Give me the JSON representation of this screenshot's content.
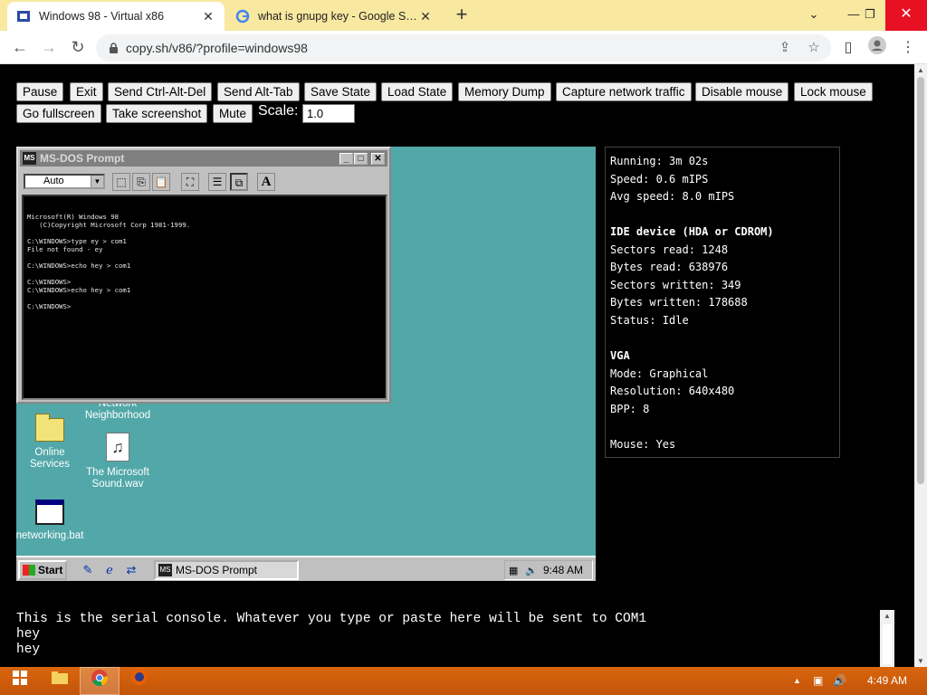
{
  "browser": {
    "tabs": [
      {
        "title": "Windows 98 - Virtual x86",
        "active": true,
        "favicon": "v86-icon"
      },
      {
        "title": "what is gnupg key - Google Search",
        "active": false,
        "favicon": "google-icon"
      }
    ],
    "new_tab_icon": "plus-icon",
    "window_controls": [
      "chevron-down-icon",
      "minimize-icon",
      "restore-icon",
      "close-icon"
    ],
    "nav": {
      "back": "arrow-left-icon",
      "forward": "arrow-right-icon",
      "reload": "reload-icon"
    },
    "url": "copy.sh/v86/?profile=windows98",
    "lock_icon": "lock-icon",
    "toolbar_icons": [
      "share-icon",
      "star-icon",
      "side-panel-icon",
      "profile-icon",
      "menu-icon"
    ]
  },
  "controls": {
    "buttons": [
      "Pause",
      "Exit",
      "Send Ctrl-Alt-Del",
      "Send Alt-Tab",
      "Save State",
      "Load State",
      "Memory Dump",
      "Capture network traffic",
      "Disable mouse",
      "Lock mouse",
      "Go fullscreen",
      "Take screenshot",
      "Mute"
    ],
    "scale_label": "Scale:",
    "scale_value": "1.0"
  },
  "emulator": {
    "dos_window": {
      "title": "MS-DOS Prompt",
      "font_dropdown": "Auto",
      "toolbar_icons": [
        "mark-icon",
        "copy-icon",
        "paste-icon",
        "fullscreen-icon",
        "properties-icon",
        "background-icon",
        "font-icon"
      ],
      "font_tool_label": "A",
      "lines": [
        "Microsoft(R) Windows 98",
        "   (C)Copyright Microsoft Corp 1981-1999.",
        "",
        "C:\\WINDOWS>type ey > com1",
        "File not found - ey",
        "",
        "C:\\WINDOWS>echo hey > com1",
        "",
        "C:\\WINDOWS>",
        "C:\\WINDOWS>echo hey > com1",
        "",
        "C:\\WINDOWS>"
      ]
    },
    "desktop_icons": [
      {
        "label": "Network\nNeighborhood",
        "icon": "network-icon"
      },
      {
        "label": "Online\nServices",
        "icon": "folder-icon"
      },
      {
        "label": "The Microsoft\nSound.wav",
        "icon": "sound-file-icon"
      },
      {
        "label": "networking.bat",
        "icon": "batch-file-icon"
      }
    ],
    "taskbar": {
      "start_label": "Start",
      "quick_launch": [
        "desktop-icon",
        "ie-icon",
        "channels-icon"
      ],
      "task_item": "MS-DOS Prompt",
      "clock": "9:48 AM",
      "tray_icons": [
        "scheduler-icon",
        "volume-icon"
      ]
    }
  },
  "stats": {
    "lines": [
      "Running: 3m 02s",
      "Speed: 0.6 mIPS",
      "Avg speed: 8.0 mIPS",
      "",
      "IDE device (HDA or CDROM)",
      "Sectors read: 1248",
      "Bytes read: 638976",
      "Sectors written: 349",
      "Bytes written: 178688",
      "Status: Idle",
      "",
      "VGA",
      "Mode: Graphical",
      "Resolution: 640x480",
      "BPP: 8",
      "",
      "Mouse: Yes"
    ],
    "bold_lines": [
      4,
      11
    ]
  },
  "serial_console": {
    "text": "This is the serial console. Whatever you type or paste here will be sent to COM1\nhey\nhey"
  },
  "os_taskbar": {
    "apps": [
      "windows-start-icon",
      "file-explorer-icon",
      "chrome-icon",
      "firefox-icon"
    ],
    "tray_icons": [
      "up-arrow-icon",
      "network-icon",
      "speaker-icon"
    ],
    "clock": "4:49 AM"
  }
}
